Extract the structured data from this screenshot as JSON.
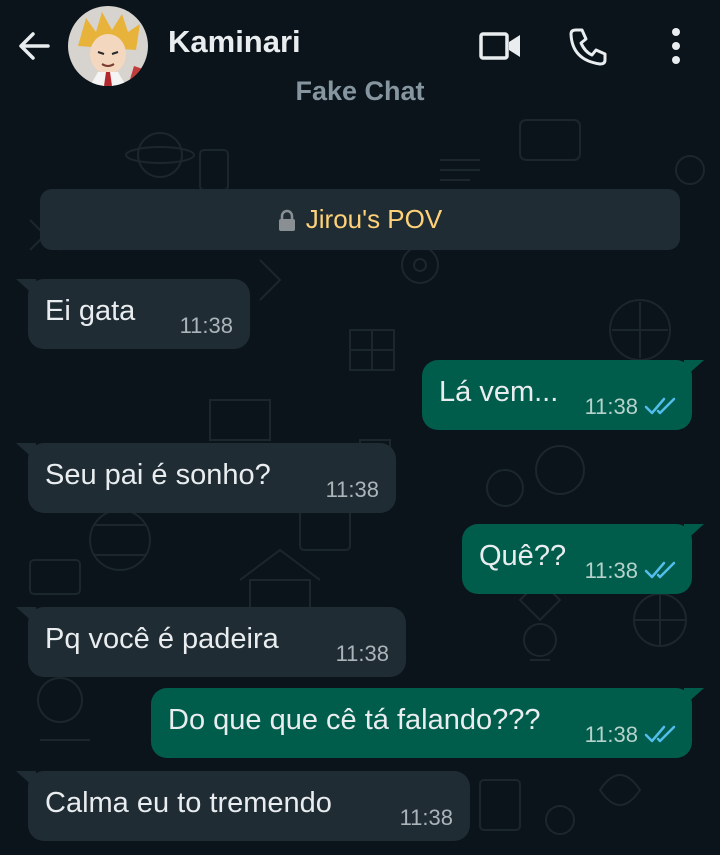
{
  "header": {
    "contact_name": "Kaminari",
    "subtitle": "Fake Chat"
  },
  "system_message": "Jirou's POV",
  "messages": [
    {
      "direction": "incoming",
      "text": "Ei gata",
      "time": "11:38"
    },
    {
      "direction": "outgoing",
      "text": "Lá vem...",
      "time": "11:38",
      "status": "read"
    },
    {
      "direction": "incoming",
      "text": "Seu pai é sonho?",
      "time": "11:38"
    },
    {
      "direction": "outgoing",
      "text": "Quê??",
      "time": "11:38",
      "status": "read"
    },
    {
      "direction": "incoming",
      "text": "Pq você é padeira",
      "time": "11:38"
    },
    {
      "direction": "outgoing",
      "text": "Do que que cê tá falando???",
      "time": "11:38",
      "status": "read"
    },
    {
      "direction": "incoming",
      "text": "Calma eu to tremendo",
      "time": "11:38"
    }
  ],
  "colors": {
    "background": "#0b141a",
    "incoming_bubble": "#1f2c34",
    "outgoing_bubble": "#005c4b",
    "system_text": "#ffd279",
    "read_ticks": "#53bdeb"
  },
  "icons": [
    "back-arrow-icon",
    "video-call-icon",
    "phone-icon",
    "more-options-icon",
    "lock-icon",
    "double-check-icon"
  ]
}
